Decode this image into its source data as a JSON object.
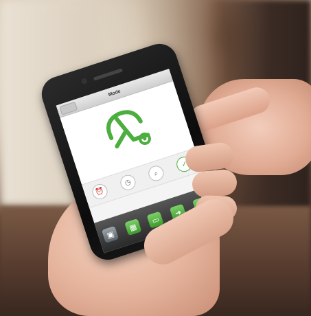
{
  "scene": {
    "description_visible_text": false
  },
  "app": {
    "title": "Mode",
    "back_label": "",
    "caption": ""
  },
  "icons": {
    "brand_logo": "wheelbarrow-logo",
    "row": [
      "alarm-icon",
      "clock-icon",
      "magnifier-icon",
      "wheelbarrow-icon"
    ],
    "dock": [
      "home-icon",
      "grid-icon",
      "screen-icon",
      "arrow-icon",
      "list-icon"
    ]
  },
  "colors": {
    "accent_green": "#4cae3e",
    "badge_red": "#e03020"
  }
}
